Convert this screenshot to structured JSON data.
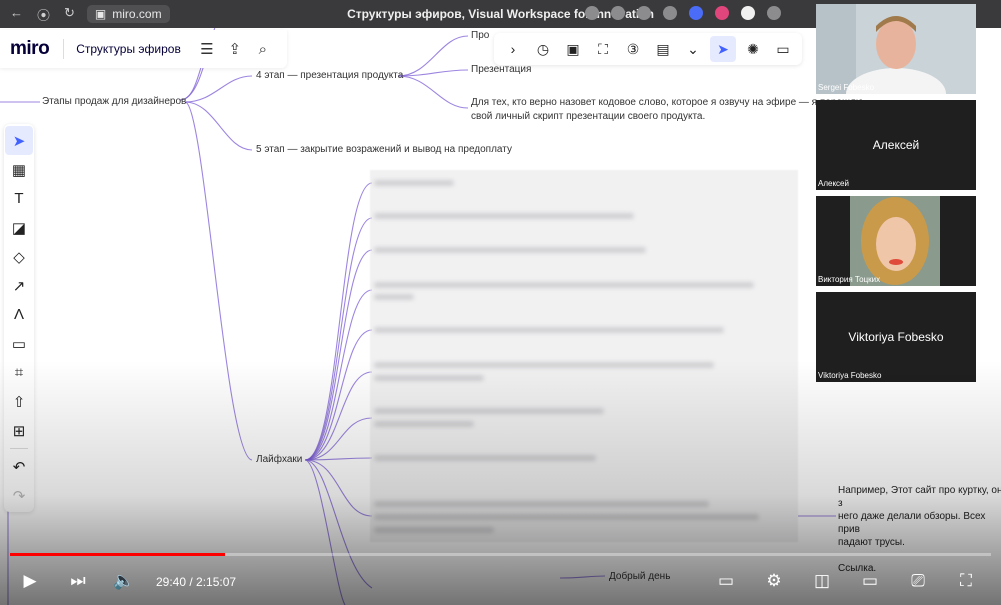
{
  "browser": {
    "url": "miro.com",
    "title": "Структуры эфиров, Visual Workspace for Innovation"
  },
  "board": {
    "logo": "miro",
    "name": "Структуры эфиров"
  },
  "mindmap": {
    "root": "Этапы продаж для дизайнеров",
    "stage4": "4 этап — презентация продукта",
    "stage4_children": [
      "Про",
      "Презентация",
      "Для тех, кто верно назовет кодовое слово, которое я озвучу на эфире — я перешлю",
      "свой личный скрипт презентации своего продукта."
    ],
    "stage5": "5 этап — закрытие возражений и вывод на предоплату",
    "lifehacks": "Лайфхаки",
    "bottom_node": "Добрый день"
  },
  "participants": [
    {
      "name": "Sergei Fobesko",
      "video": true
    },
    {
      "name": "Алексей",
      "display": "Алексей",
      "video": false
    },
    {
      "name": "Виктория Тоцких",
      "video": true
    },
    {
      "name": "Viktoriya Fobesko",
      "display": "Viktoriya Fobesko",
      "video": false
    }
  ],
  "right_note": {
    "line1": "Например, Этот сайт про куртку, он з",
    "line2": "него даже делали обзоры. Всех прив",
    "line3": "падают трусы.",
    "line4": "Ссылка."
  },
  "player": {
    "current_time": "29:40",
    "separator": " / ",
    "duration": "2:15:07",
    "progress_fraction": 0.219,
    "accent": "#ff0000"
  },
  "colors": {
    "branch": "#7b5cd6",
    "miro_active": "#4262ff"
  }
}
